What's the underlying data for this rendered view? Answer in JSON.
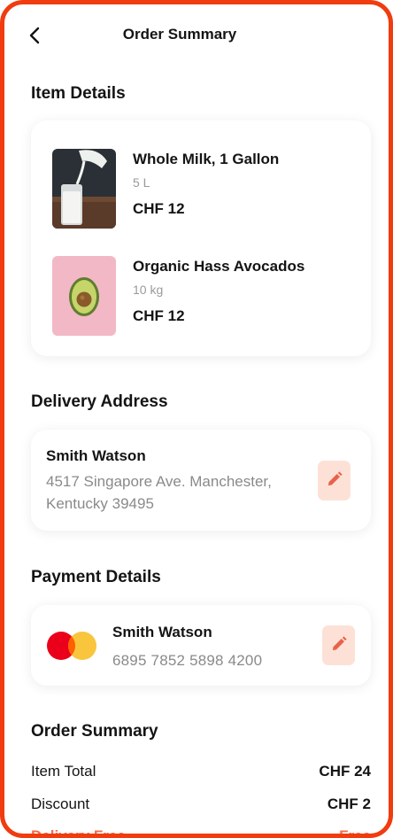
{
  "header": {
    "title": "Order Summary",
    "back_icon": "chevron-left-icon"
  },
  "colors": {
    "accent": "#f03c0f",
    "edit_bg": "#fde1d6",
    "edit_icon": "#e8624a",
    "muted": "#8a8a8a"
  },
  "item_details": {
    "title": "Item Details",
    "items": [
      {
        "name": "Whole Milk, 1 Gallon",
        "qty": "5 L",
        "price": "CHF 12",
        "image": "milk-glass-image"
      },
      {
        "name": "Organic Hass Avocados",
        "qty": "10 kg",
        "price": "CHF 12",
        "image": "avocado-image"
      }
    ]
  },
  "delivery": {
    "title": "Delivery Address",
    "name": "Smith Watson",
    "line1": "4517 Singapore Ave. Manchester,",
    "line2": "Kentucky 39495",
    "edit_icon": "pencil-icon"
  },
  "payment": {
    "title": "Payment Details",
    "name": "Smith Watson",
    "number": "6895 7852 5898 4200",
    "card_brand_icon": "mastercard-icon",
    "edit_icon": "pencil-icon"
  },
  "summary": {
    "title": "Order Summary",
    "rows": [
      {
        "label": "Item Total",
        "value": "CHF 24"
      },
      {
        "label": "Discount",
        "value": "CHF 2"
      },
      {
        "label": "Delivery Free",
        "value": "Free"
      }
    ]
  }
}
